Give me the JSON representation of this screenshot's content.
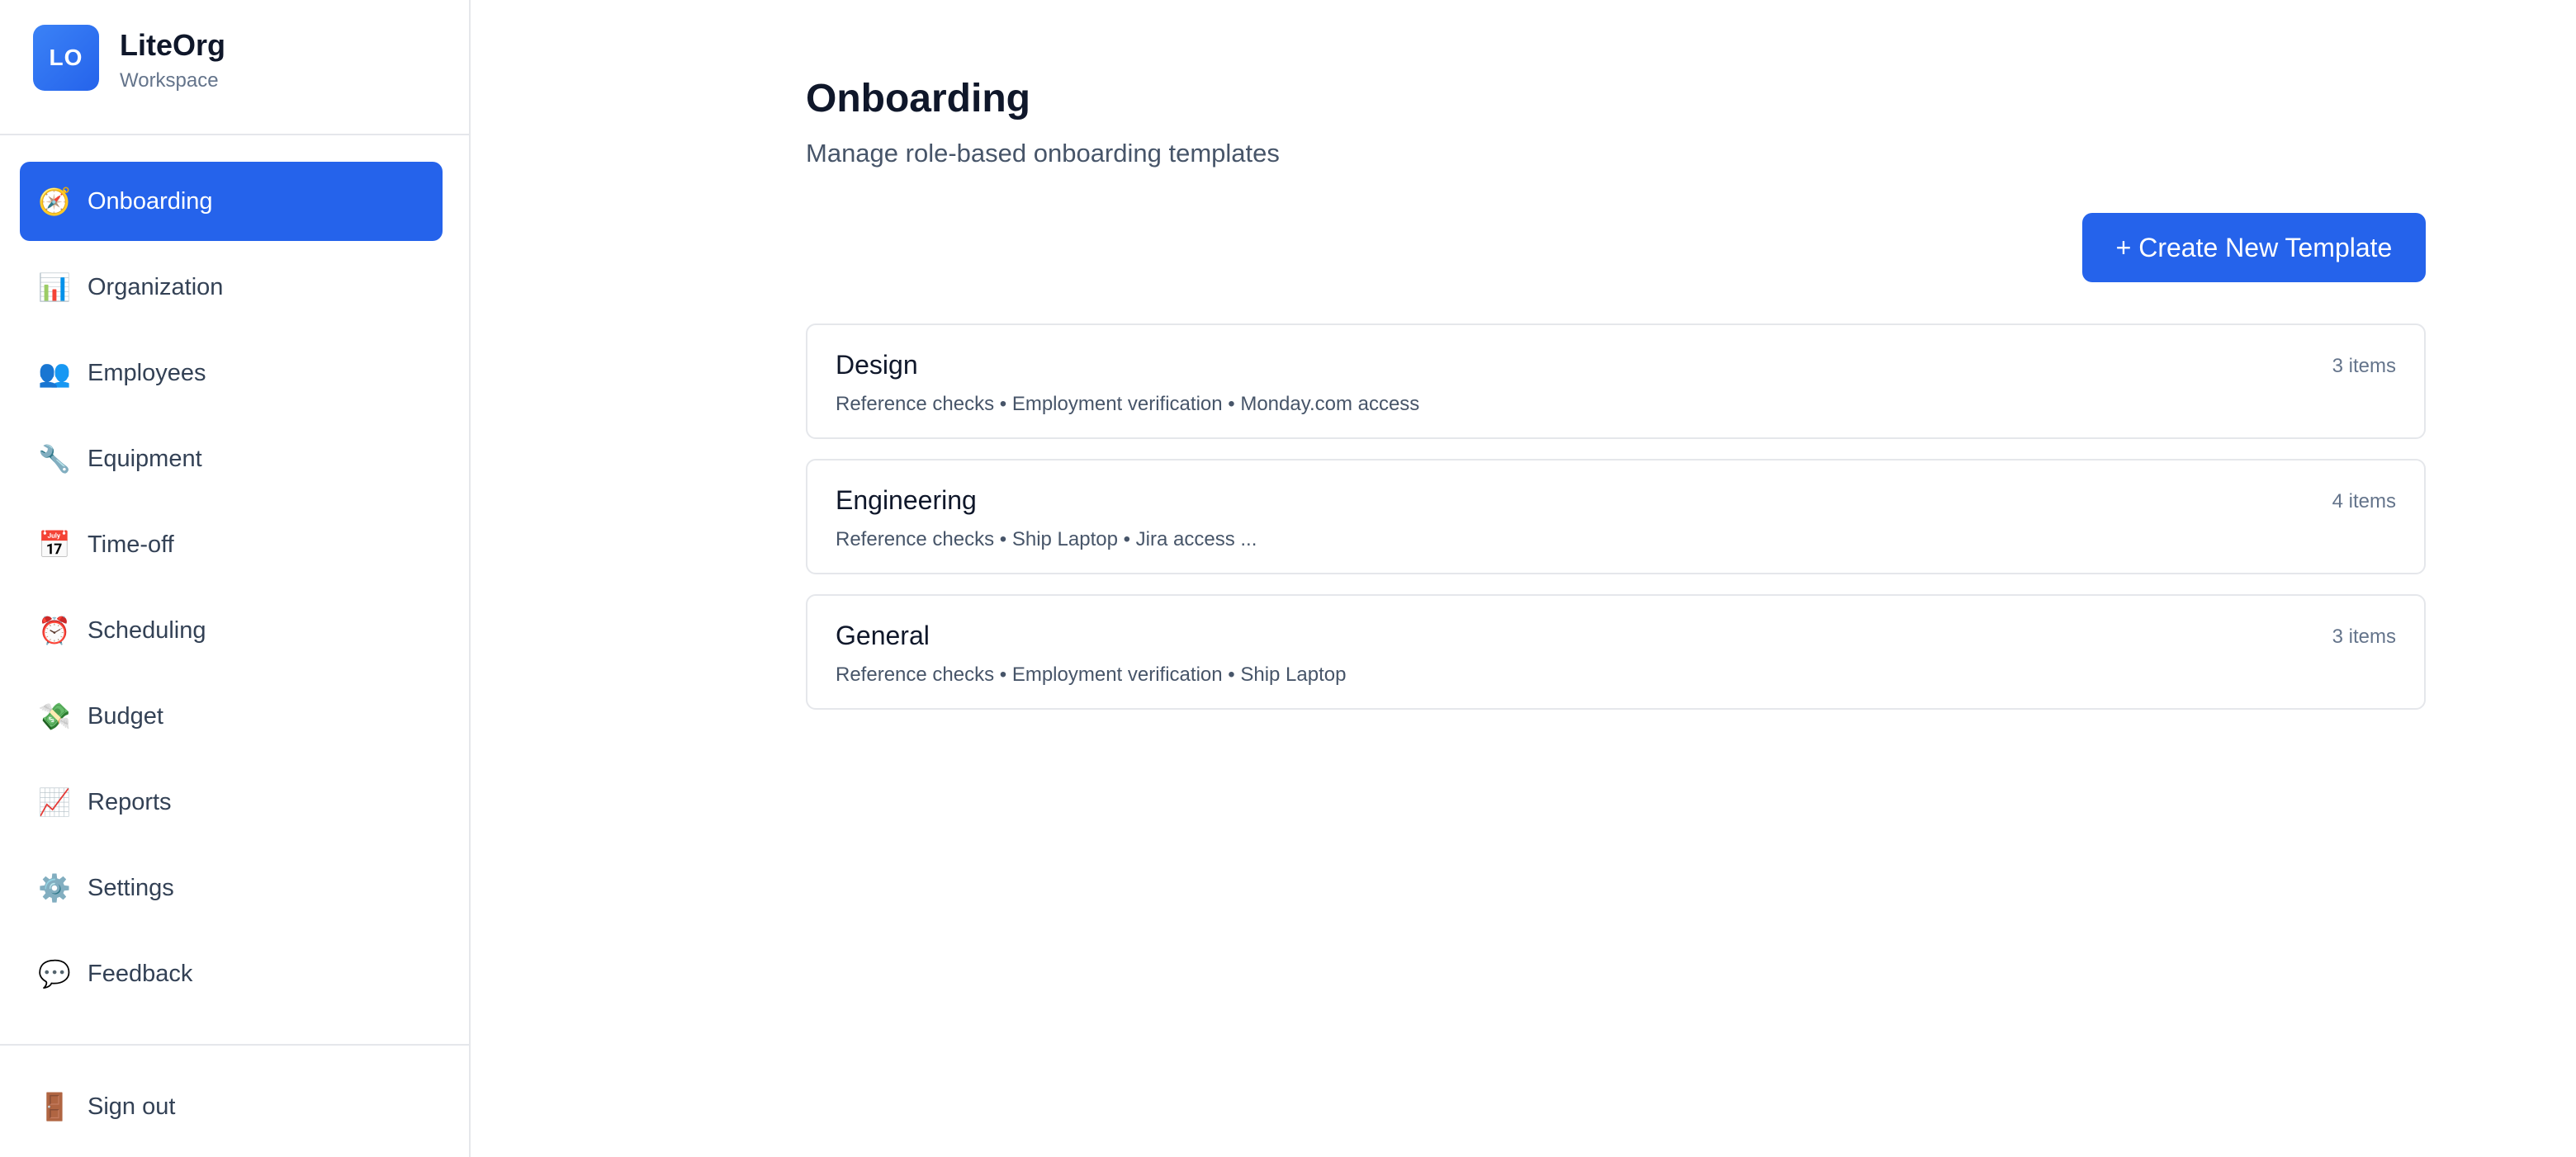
{
  "brand": {
    "logo_text": "LO",
    "name": "LiteOrg",
    "subtitle": "Workspace"
  },
  "sidebar": {
    "items": [
      {
        "label": "Onboarding",
        "icon": "compass-icon",
        "glyph": "🧭",
        "active": true
      },
      {
        "label": "Organization",
        "icon": "bar-chart-icon",
        "glyph": "📊",
        "active": false
      },
      {
        "label": "Employees",
        "icon": "people-icon",
        "glyph": "👥",
        "active": false
      },
      {
        "label": "Equipment",
        "icon": "wrench-icon",
        "glyph": "🔧",
        "active": false
      },
      {
        "label": "Time-off",
        "icon": "calendar-icon",
        "glyph": "📅",
        "active": false
      },
      {
        "label": "Scheduling",
        "icon": "alarm-clock-icon",
        "glyph": "⏰",
        "active": false
      },
      {
        "label": "Budget",
        "icon": "money-icon",
        "glyph": "💸",
        "active": false
      },
      {
        "label": "Reports",
        "icon": "line-chart-icon",
        "glyph": "📈",
        "active": false
      },
      {
        "label": "Settings",
        "icon": "gear-icon",
        "glyph": "⚙️",
        "active": false
      },
      {
        "label": "Feedback",
        "icon": "speech-bubble-icon",
        "glyph": "💬",
        "active": false
      }
    ],
    "signout": {
      "label": "Sign out",
      "icon": "door-icon",
      "glyph": "🚪"
    }
  },
  "main": {
    "title": "Onboarding",
    "subtitle": "Manage role-based onboarding templates",
    "create_label": "+ Create New Template",
    "templates": [
      {
        "name": "Design",
        "count": "3 items",
        "items": "Reference checks • Employment verification • Monday.com access"
      },
      {
        "name": "Engineering",
        "count": "4 items",
        "items": "Reference checks • Ship Laptop • Jira access ..."
      },
      {
        "name": "General",
        "count": "3 items",
        "items": "Reference checks • Employment verification • Ship Laptop"
      }
    ]
  },
  "colors": {
    "accent": "#2563eb",
    "border": "#e5e7eb",
    "text": "#0f172a",
    "muted": "#64748b"
  }
}
